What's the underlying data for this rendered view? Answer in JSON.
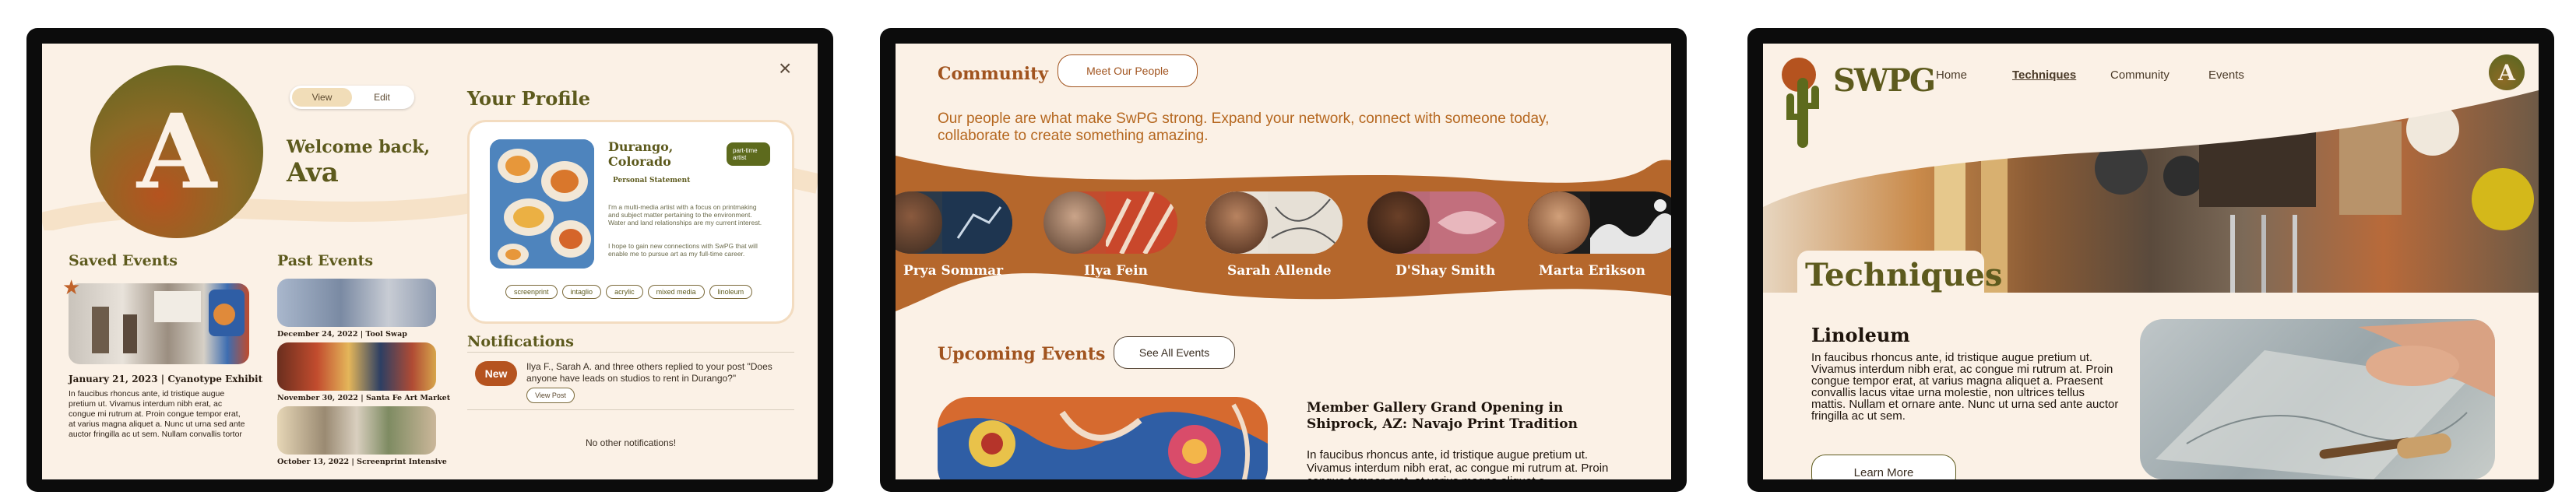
{
  "screen1": {
    "toggle": {
      "view": "View",
      "edit": "Edit"
    },
    "avatar_letter": "A",
    "welcome": "Welcome back,",
    "name": "Ava",
    "close": "×",
    "saved_events": {
      "heading": "Saved Events",
      "caption": "January 21, 2023 | Cyanotype Exhibit",
      "body": "In faucibus rhoncus ante, id tristique augue pretium ut. Vivamus interdum nibh erat, ac congue mi rutrum at. Proin congue tempor erat, at varius magna aliquet a. Nunc ut urna sed ante auctor fringilla ac ut sem. Nullam convallis tortor"
    },
    "past_events": {
      "heading": "Past Events",
      "items": [
        {
          "caption": "December 24, 2022 | Tool Swap"
        },
        {
          "caption": "November 30, 2022 | Santa Fe Art Market"
        },
        {
          "caption": "October 13, 2022 | Screenprint Intensive"
        }
      ]
    },
    "profile": {
      "heading": "Your Profile",
      "location": "Durango, Colorado",
      "badge": "part-time artist",
      "statement_label": "Personal Statement",
      "statement_1": "I'm a multi-media artist with a focus on printmaking and subject matter pertaining to the environment. Water and land relationships are my current interest.",
      "statement_2": "I hope to gain new connections with SwPG that will enable me to pursue art as my full-time career.",
      "tags": [
        "screenprint",
        "intaglio",
        "acrylic",
        "mixed media",
        "linoleum"
      ]
    },
    "notifications": {
      "heading": "Notifications",
      "new_badge": "New",
      "message": "Ilya F., Sarah A. and three others replied to your post \"Does anyone have leads on studios to rent in Durango?\"",
      "view_post": "View Post",
      "empty": "No other notifications!"
    }
  },
  "screen2": {
    "community_heading": "Community",
    "meet_button": "Meet Our People",
    "intro": "Our people are what make SwPG strong. Expand your network, connect with someone today, collaborate to create something amazing.",
    "people": [
      {
        "name": "Prya Sommar"
      },
      {
        "name": "Ilya Fein"
      },
      {
        "name": "Sarah Allende"
      },
      {
        "name": "D'Shay Smith"
      },
      {
        "name": "Marta Erikson"
      }
    ],
    "upcoming_heading": "Upcoming Events",
    "see_all": "See All Events",
    "event_title": "Member Gallery Grand Opening in Shiprock, AZ: Navajo Print Tradition",
    "event_body": "In faucibus rhoncus ante, id tristique augue pretium ut. Vivamus interdum nibh erat, ac congue mi rutrum at. Proin congue tempor erat, at varius magna aliquet a."
  },
  "screen3": {
    "logo_text": "SWPG",
    "nav": [
      "Home",
      "Techniques",
      "Community",
      "Events"
    ],
    "avatar_letter": "A",
    "hero_title": "Techniques",
    "section_title": "Linoleum",
    "section_body": "In faucibus rhoncus ante, id tristique augue pretium ut. Vivamus interdum nibh erat, ac congue mi rutrum at. Proin congue tempor erat, at varius magna aliquet a. Praesent convallis lacus vitae urna molestie, non ultrices tellus mattis. Nullam et ornare ante. Nunc ut urna sed ante auctor fringilla ac ut sem.",
    "learn_more": "Learn More"
  },
  "colors": {
    "cream": "#fbf1e6",
    "rust": "#b5531f",
    "olive": "#5d5a1d",
    "brown": "#a1541f"
  }
}
